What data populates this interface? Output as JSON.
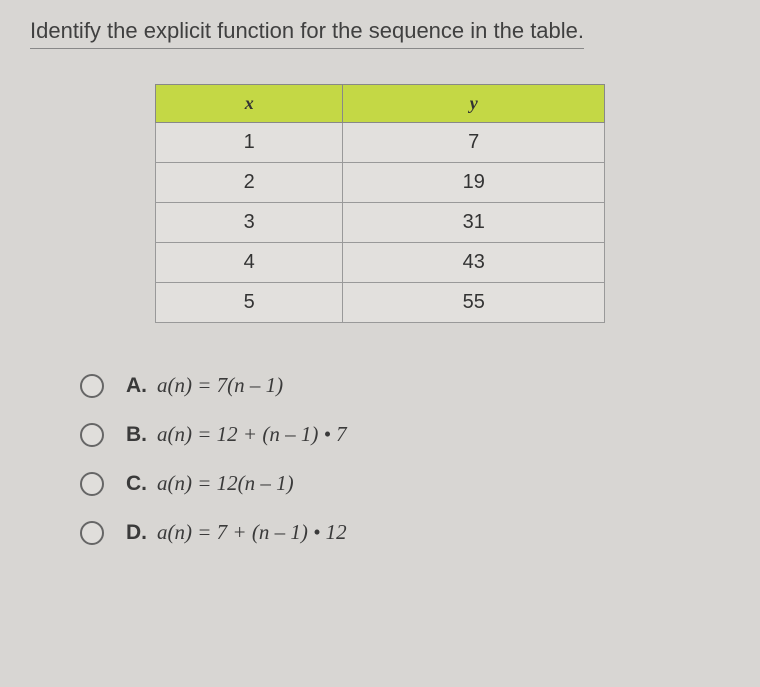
{
  "question": "Identify the explicit function for the sequence in the table.",
  "table": {
    "headers": {
      "col1": "x",
      "col2": "y"
    },
    "rows": [
      {
        "x": "1",
        "y": "7"
      },
      {
        "x": "2",
        "y": "19"
      },
      {
        "x": "3",
        "y": "31"
      },
      {
        "x": "4",
        "y": "43"
      },
      {
        "x": "5",
        "y": "55"
      }
    ]
  },
  "options": [
    {
      "label": "A.",
      "formula": "a(n) = 7(n – 1)"
    },
    {
      "label": "B.",
      "formula": "a(n) = 12 + (n – 1) • 7"
    },
    {
      "label": "C.",
      "formula": "a(n) = 12(n – 1)"
    },
    {
      "label": "D.",
      "formula": "a(n) = 7 + (n – 1) • 12"
    }
  ],
  "chart_data": {
    "type": "table",
    "columns": [
      "x",
      "y"
    ],
    "rows": [
      [
        1,
        7
      ],
      [
        2,
        19
      ],
      [
        3,
        31
      ],
      [
        4,
        43
      ],
      [
        5,
        55
      ]
    ]
  }
}
